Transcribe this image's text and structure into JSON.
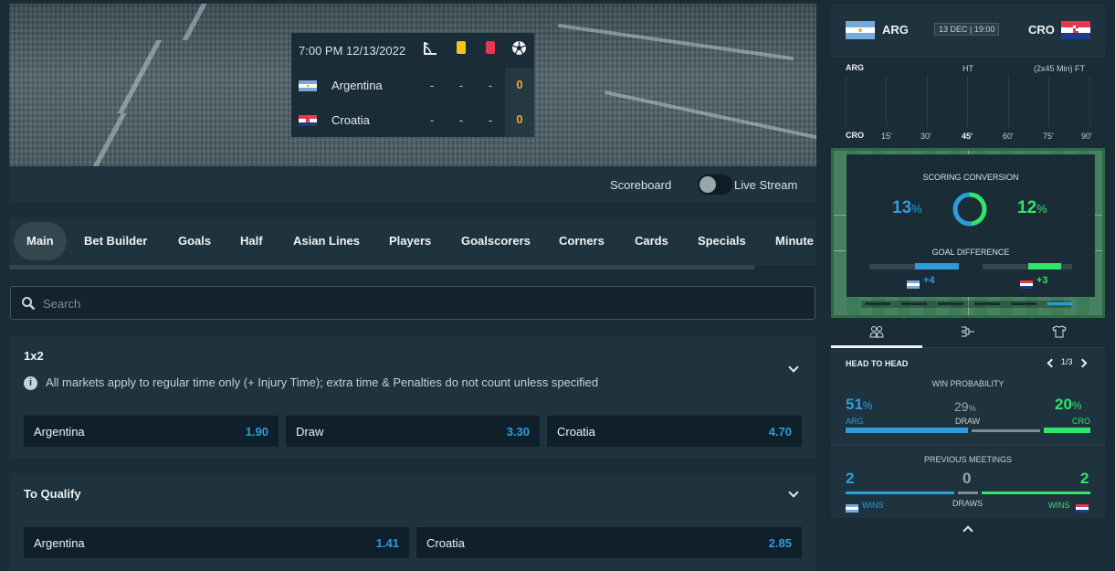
{
  "scoreboard": {
    "datetime": "7:00 PM 12/13/2022",
    "columns": [
      "corner-icon",
      "yellow-card-icon",
      "red-card-icon",
      "goal-ball-icon"
    ],
    "teams": [
      {
        "name": "Argentina",
        "corners": "-",
        "yellow": "-",
        "red": "-",
        "goals": "0"
      },
      {
        "name": "Croatia",
        "corners": "-",
        "yellow": "-",
        "red": "-",
        "goals": "0"
      }
    ]
  },
  "stream": {
    "scoreboard_label": "Scoreboard",
    "live_label": "Live Stream"
  },
  "tabs": [
    "Main",
    "Bet Builder",
    "Goals",
    "Half",
    "Asian Lines",
    "Players",
    "Goalscorers",
    "Corners",
    "Cards",
    "Specials",
    "Minute"
  ],
  "search": {
    "placeholder": "Search"
  },
  "markets": [
    {
      "title": "1x2",
      "info": "All markets apply to regular time only (+ Injury Time); extra time & Penalties do not count unless specified",
      "odds": [
        {
          "name": "Argentina",
          "price": "1.90"
        },
        {
          "name": "Draw",
          "price": "3.30"
        },
        {
          "name": "Croatia",
          "price": "4.70"
        }
      ]
    },
    {
      "title": "To Qualify",
      "odds": [
        {
          "name": "Argentina",
          "price": "1.41"
        },
        {
          "name": "Croatia",
          "price": "2.85"
        }
      ]
    }
  ],
  "panel": {
    "home": "ARG",
    "away": "CRO",
    "date": "13 DEC | 19:00",
    "timeline": {
      "home": "ARG",
      "away": "CRO",
      "ht": "HT",
      "ft": "(2x45 Min) FT",
      "minutes": [
        "15'",
        "30'",
        "45'",
        "60'",
        "75'",
        "90'"
      ]
    },
    "scoring": {
      "title": "SCORING CONVERSION",
      "home_pct": "13",
      "away_pct": "12",
      "pct_sign": "%",
      "gd_title": "GOAL DIFFERENCE",
      "home_gd": "+4",
      "away_gd": "+3"
    },
    "tab_icons": [
      "head-to-head-icon",
      "lineup-icon",
      "kit-icon"
    ],
    "h2h": {
      "title": "HEAD TO HEAD",
      "page": "1/3",
      "win_prob_title": "WIN PROBABILITY",
      "home_pct": "51",
      "draw_pct": "29",
      "away_pct": "20",
      "pct_sign": "%",
      "home_label": "ARG",
      "draw_label": "DRAW",
      "away_label": "CRO",
      "meetings_title": "PREVIOUS MEETINGS",
      "home_wins": "2",
      "draws": "0",
      "away_wins": "2",
      "wins_label": "WINS",
      "draws_label": "DRAWS"
    }
  },
  "colors": {
    "accent_blue": "#2d9cdb",
    "accent_green": "#2ee66a",
    "accent_orange": "#f5a524",
    "background": "#1a2c35"
  }
}
